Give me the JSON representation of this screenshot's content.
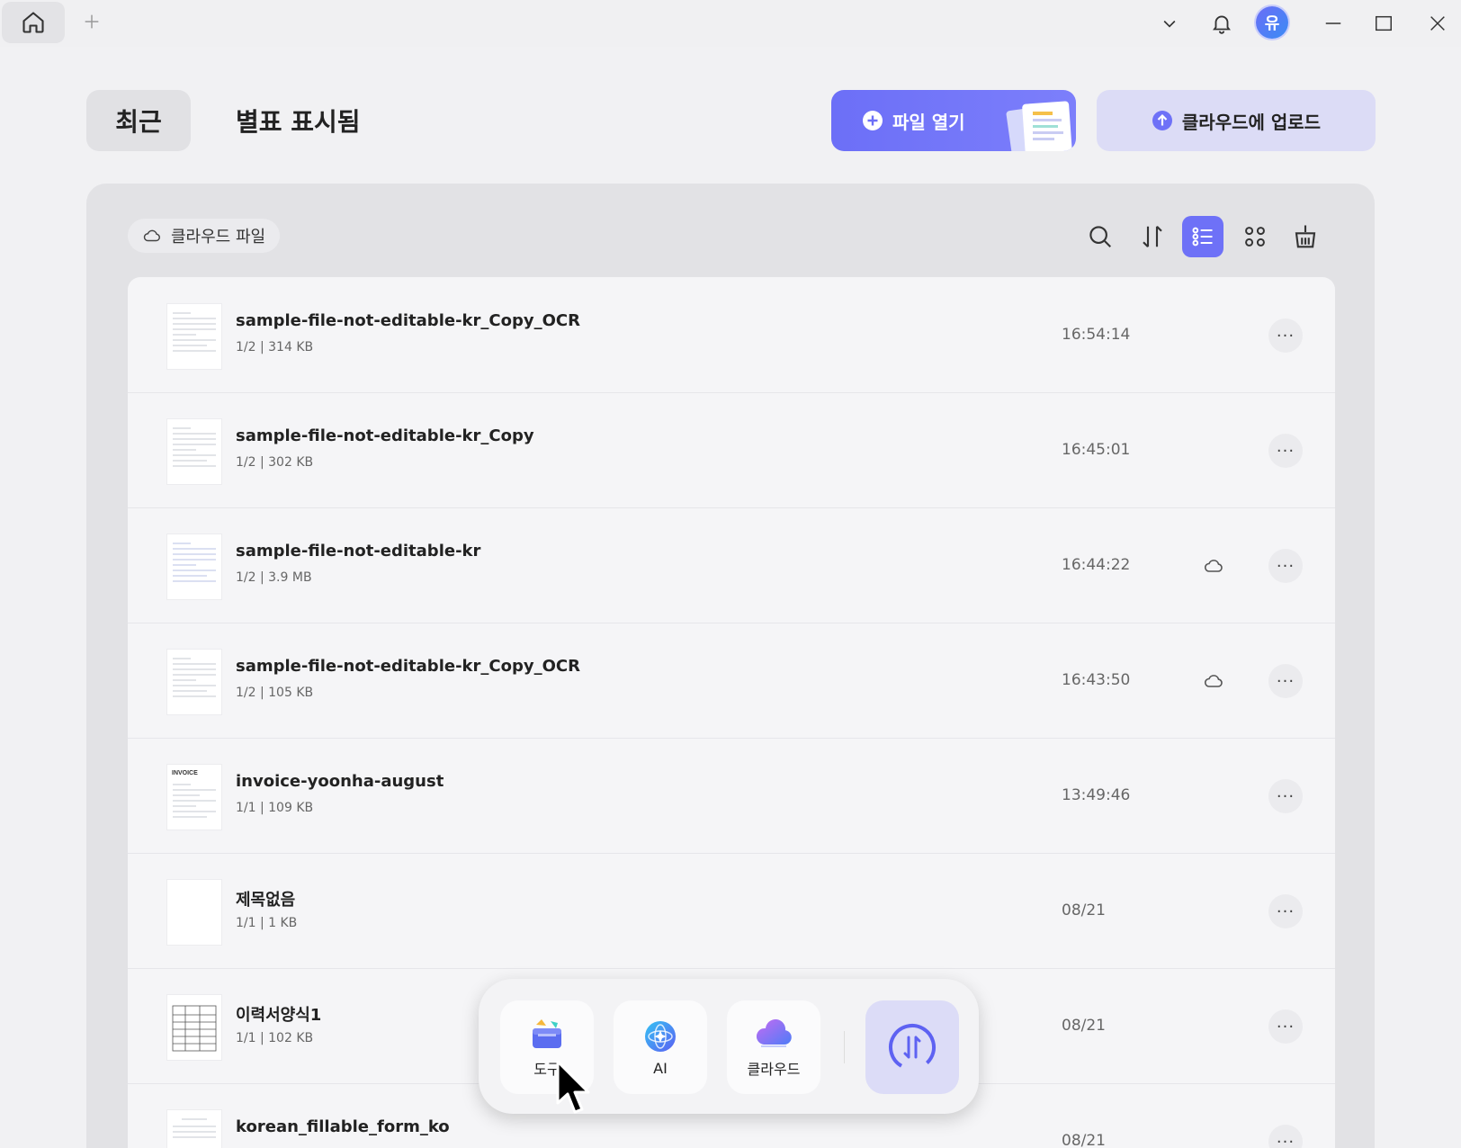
{
  "titlebar": {
    "icons": [
      "home-icon",
      "plus-icon",
      "chevron-down-icon",
      "bell-icon",
      "minimize-icon",
      "maximize-icon",
      "close-icon"
    ],
    "avatar_initial": "유"
  },
  "header": {
    "tab_recent": "최근",
    "tab_starred": "별표 표시됨",
    "open_file": "파일 열기",
    "upload_cloud": "클라우드에 업로드"
  },
  "toolbar": {
    "cloud_files": "클라우드 파일",
    "icons": [
      "search-icon",
      "sort-icon",
      "list-view-icon",
      "grid-view-icon",
      "basket-icon"
    ]
  },
  "files": [
    {
      "name": "sample-file-not-editable-kr_Copy_OCR",
      "meta": "1/2 | 314 KB",
      "time": "16:54:14",
      "cloud": false
    },
    {
      "name": "sample-file-not-editable-kr_Copy",
      "meta": "1/2 | 302 KB",
      "time": "16:45:01",
      "cloud": false
    },
    {
      "name": "sample-file-not-editable-kr",
      "meta": "1/2 | 3.9 MB",
      "time": "16:44:22",
      "cloud": true
    },
    {
      "name": "sample-file-not-editable-kr_Copy_OCR",
      "meta": "1/2 | 105 KB",
      "time": "16:43:50",
      "cloud": true
    },
    {
      "name": "invoice-yoonha-august",
      "meta": "1/1 | 109 KB",
      "time": "13:49:46",
      "cloud": false
    },
    {
      "name": "제목없음",
      "meta": "1/1 | 1 KB",
      "time": "08/21",
      "cloud": false
    },
    {
      "name": "이력서양식1",
      "meta": "1/1 | 102 KB",
      "time": "08/21",
      "cloud": false
    },
    {
      "name": "korean_fillable_form_ko",
      "meta": "",
      "time": "08/21",
      "cloud": false
    }
  ],
  "more_glyph": "···",
  "invoice_thumb_label": "INVOICE",
  "dock": {
    "tools": "도구",
    "ai": "AI",
    "cloud": "클라우드"
  },
  "colors": {
    "accent": "#6e71f7",
    "upload_bg": "#dcdcf6",
    "panel_bg": "#e2e2e5"
  }
}
